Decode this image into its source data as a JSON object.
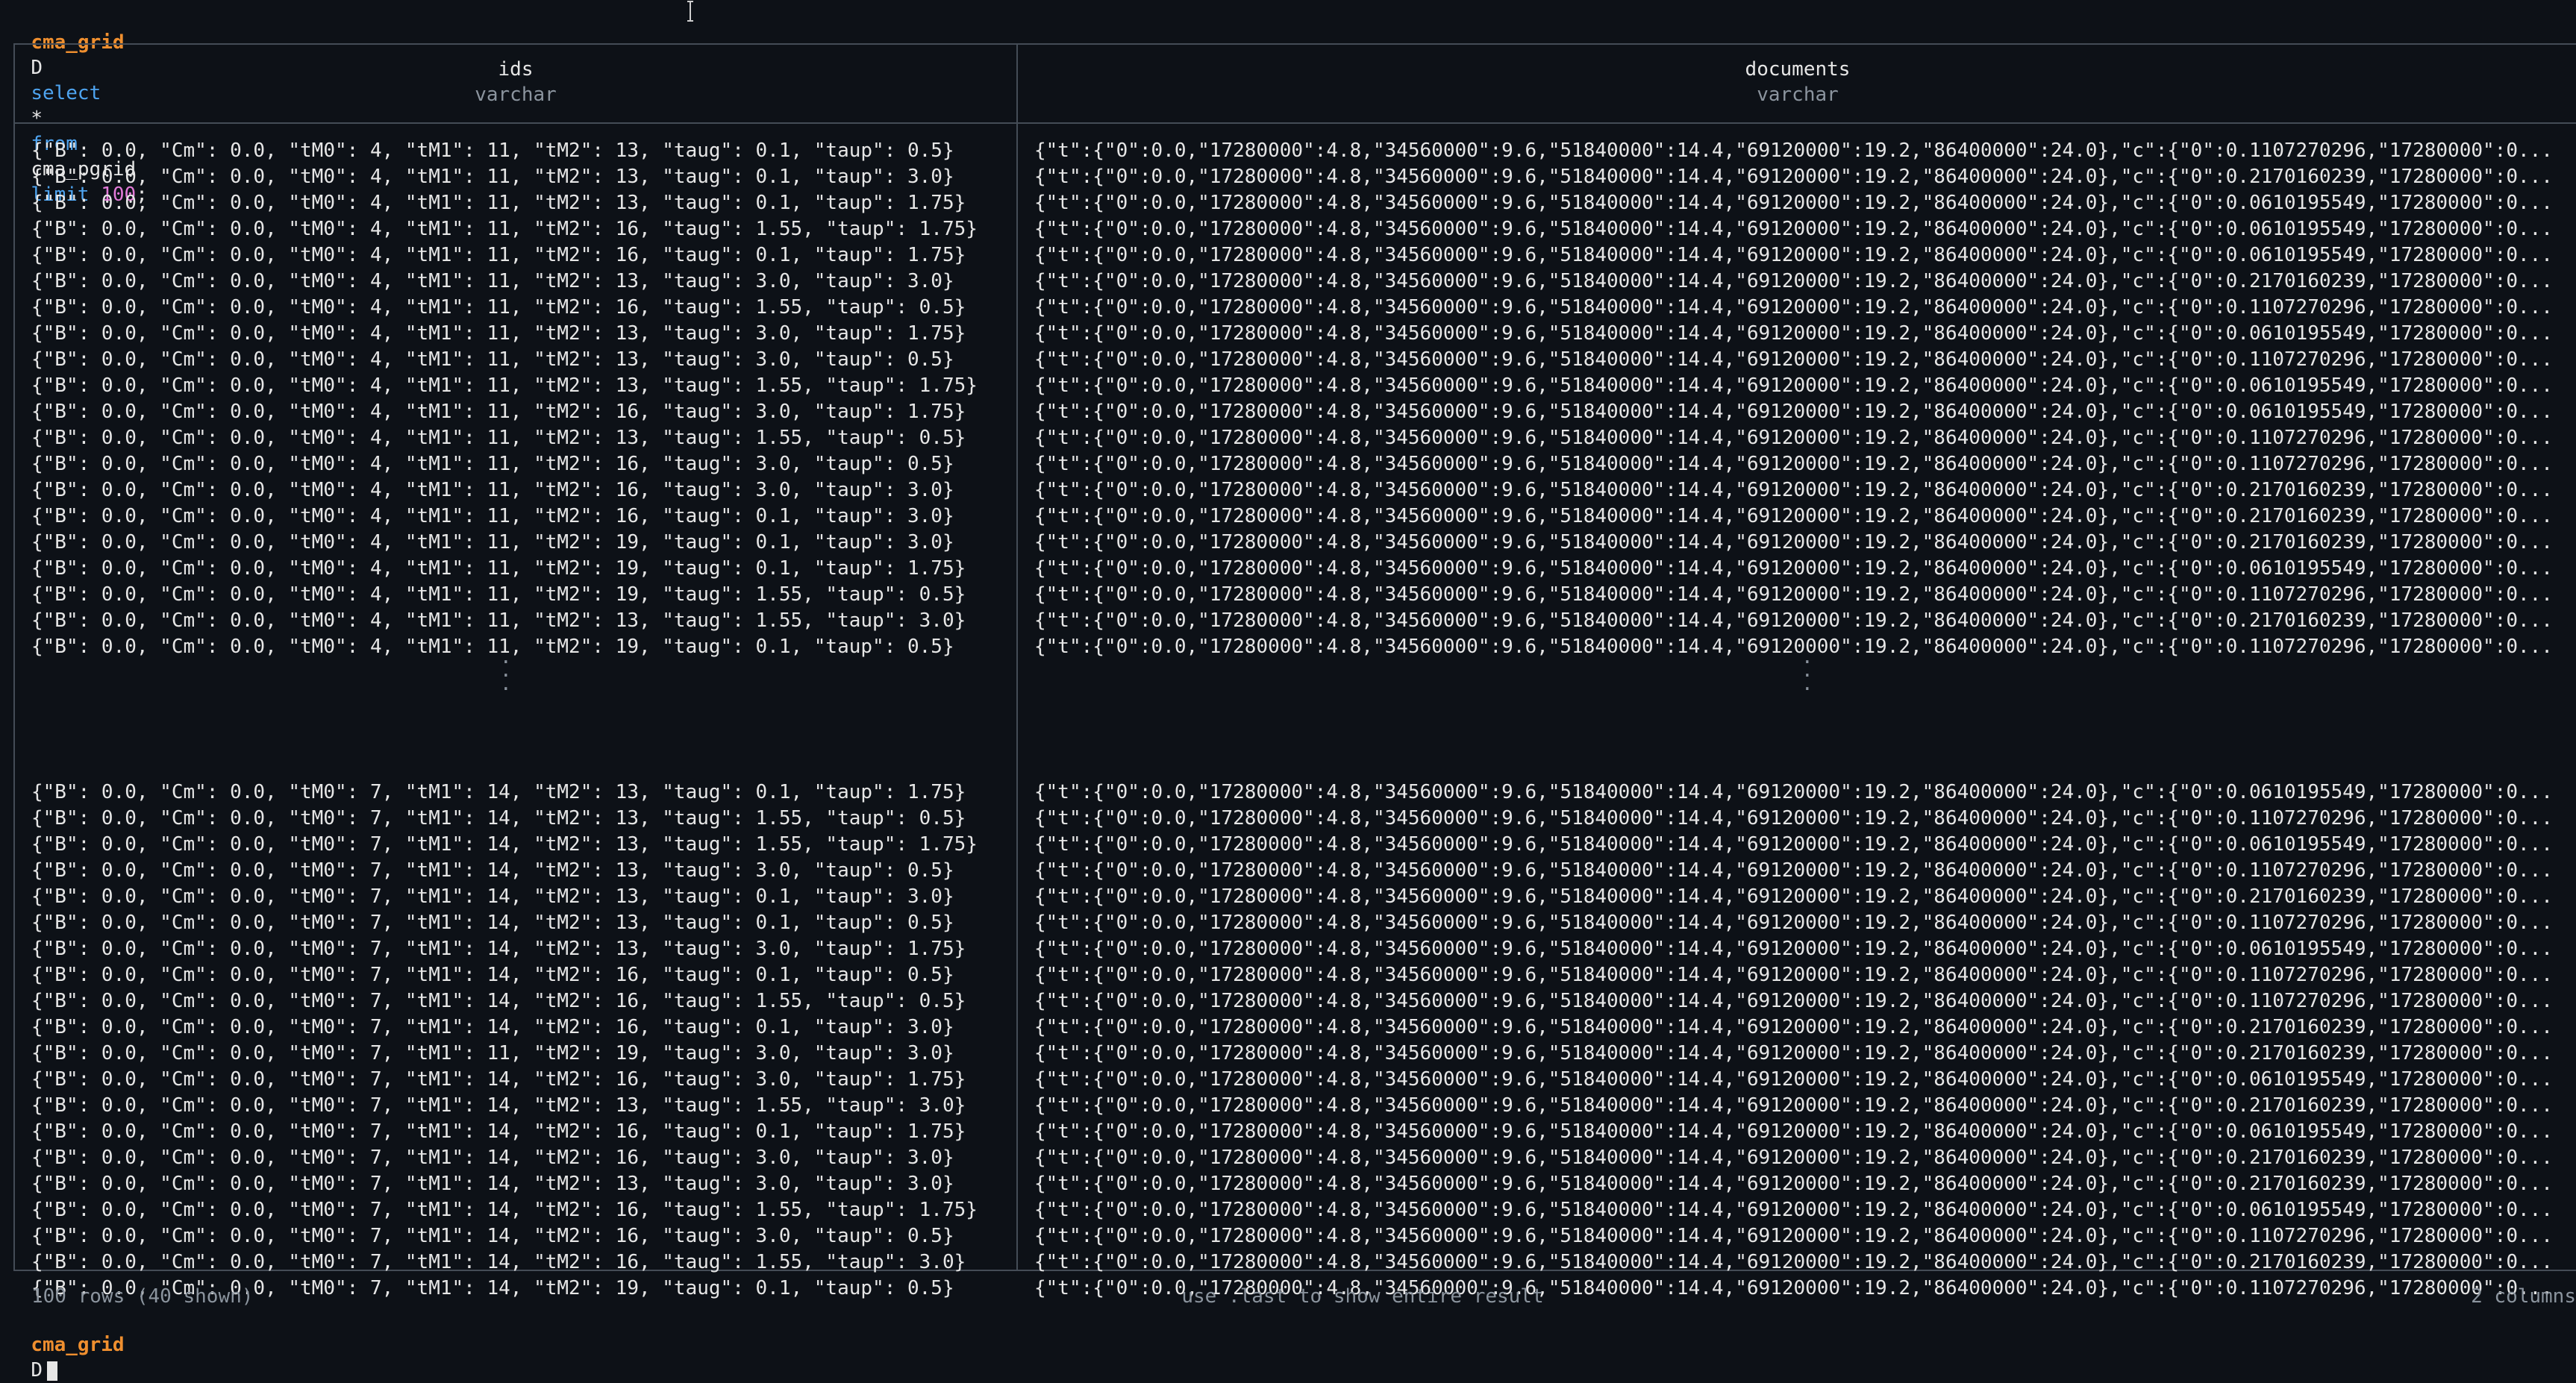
{
  "prompt": {
    "db": "cma_grid",
    "symbol": "D",
    "query_kw1": "select",
    "query_star": "*",
    "query_kw2": "from",
    "query_table": "cma_pgrid",
    "query_kw3": "limit",
    "query_limit": "100",
    "query_end": ";"
  },
  "columns": [
    {
      "name": "ids",
      "type": "varchar"
    },
    {
      "name": "documents",
      "type": "varchar"
    }
  ],
  "rows_top": [
    {
      "ids": "{\"B\": 0.0, \"Cm\": 0.0, \"tM0\": 4, \"tM1\": 11, \"tM2\": 13, \"taug\": 0.1, \"taup\": 0.5}",
      "doc": "{\"t\":{\"0\":0.0,\"17280000\":4.8,\"34560000\":9.6,\"51840000\":14.4,\"69120000\":19.2,\"86400000\":24.0},\"c\":{\"0\":0.1107270296,\"17280000\":0..."
    },
    {
      "ids": "{\"B\": 0.0, \"Cm\": 0.0, \"tM0\": 4, \"tM1\": 11, \"tM2\": 13, \"taug\": 0.1, \"taup\": 3.0}",
      "doc": "{\"t\":{\"0\":0.0,\"17280000\":4.8,\"34560000\":9.6,\"51840000\":14.4,\"69120000\":19.2,\"86400000\":24.0},\"c\":{\"0\":0.2170160239,\"17280000\":0..."
    },
    {
      "ids": "{\"B\": 0.0, \"Cm\": 0.0, \"tM0\": 4, \"tM1\": 11, \"tM2\": 13, \"taug\": 0.1, \"taup\": 1.75}",
      "doc": "{\"t\":{\"0\":0.0,\"17280000\":4.8,\"34560000\":9.6,\"51840000\":14.4,\"69120000\":19.2,\"86400000\":24.0},\"c\":{\"0\":0.0610195549,\"17280000\":0..."
    },
    {
      "ids": "{\"B\": 0.0, \"Cm\": 0.0, \"tM0\": 4, \"tM1\": 11, \"tM2\": 16, \"taug\": 1.55, \"taup\": 1.75}",
      "doc": "{\"t\":{\"0\":0.0,\"17280000\":4.8,\"34560000\":9.6,\"51840000\":14.4,\"69120000\":19.2,\"86400000\":24.0},\"c\":{\"0\":0.0610195549,\"17280000\":0..."
    },
    {
      "ids": "{\"B\": 0.0, \"Cm\": 0.0, \"tM0\": 4, \"tM1\": 11, \"tM2\": 16, \"taug\": 0.1, \"taup\": 1.75}",
      "doc": "{\"t\":{\"0\":0.0,\"17280000\":4.8,\"34560000\":9.6,\"51840000\":14.4,\"69120000\":19.2,\"86400000\":24.0},\"c\":{\"0\":0.0610195549,\"17280000\":0..."
    },
    {
      "ids": "{\"B\": 0.0, \"Cm\": 0.0, \"tM0\": 4, \"tM1\": 11, \"tM2\": 13, \"taug\": 3.0, \"taup\": 3.0}",
      "doc": "{\"t\":{\"0\":0.0,\"17280000\":4.8,\"34560000\":9.6,\"51840000\":14.4,\"69120000\":19.2,\"86400000\":24.0},\"c\":{\"0\":0.2170160239,\"17280000\":0..."
    },
    {
      "ids": "{\"B\": 0.0, \"Cm\": 0.0, \"tM0\": 4, \"tM1\": 11, \"tM2\": 16, \"taug\": 1.55, \"taup\": 0.5}",
      "doc": "{\"t\":{\"0\":0.0,\"17280000\":4.8,\"34560000\":9.6,\"51840000\":14.4,\"69120000\":19.2,\"86400000\":24.0},\"c\":{\"0\":0.1107270296,\"17280000\":0..."
    },
    {
      "ids": "{\"B\": 0.0, \"Cm\": 0.0, \"tM0\": 4, \"tM1\": 11, \"tM2\": 13, \"taug\": 3.0, \"taup\": 1.75}",
      "doc": "{\"t\":{\"0\":0.0,\"17280000\":4.8,\"34560000\":9.6,\"51840000\":14.4,\"69120000\":19.2,\"86400000\":24.0},\"c\":{\"0\":0.0610195549,\"17280000\":0..."
    },
    {
      "ids": "{\"B\": 0.0, \"Cm\": 0.0, \"tM0\": 4, \"tM1\": 11, \"tM2\": 13, \"taug\": 3.0, \"taup\": 0.5}",
      "doc": "{\"t\":{\"0\":0.0,\"17280000\":4.8,\"34560000\":9.6,\"51840000\":14.4,\"69120000\":19.2,\"86400000\":24.0},\"c\":{\"0\":0.1107270296,\"17280000\":0..."
    },
    {
      "ids": "{\"B\": 0.0, \"Cm\": 0.0, \"tM0\": 4, \"tM1\": 11, \"tM2\": 13, \"taug\": 1.55, \"taup\": 1.75}",
      "doc": "{\"t\":{\"0\":0.0,\"17280000\":4.8,\"34560000\":9.6,\"51840000\":14.4,\"69120000\":19.2,\"86400000\":24.0},\"c\":{\"0\":0.0610195549,\"17280000\":0..."
    },
    {
      "ids": "{\"B\": 0.0, \"Cm\": 0.0, \"tM0\": 4, \"tM1\": 11, \"tM2\": 16, \"taug\": 3.0, \"taup\": 1.75}",
      "doc": "{\"t\":{\"0\":0.0,\"17280000\":4.8,\"34560000\":9.6,\"51840000\":14.4,\"69120000\":19.2,\"86400000\":24.0},\"c\":{\"0\":0.0610195549,\"17280000\":0..."
    },
    {
      "ids": "{\"B\": 0.0, \"Cm\": 0.0, \"tM0\": 4, \"tM1\": 11, \"tM2\": 13, \"taug\": 1.55, \"taup\": 0.5}",
      "doc": "{\"t\":{\"0\":0.0,\"17280000\":4.8,\"34560000\":9.6,\"51840000\":14.4,\"69120000\":19.2,\"86400000\":24.0},\"c\":{\"0\":0.1107270296,\"17280000\":0..."
    },
    {
      "ids": "{\"B\": 0.0, \"Cm\": 0.0, \"tM0\": 4, \"tM1\": 11, \"tM2\": 16, \"taug\": 3.0, \"taup\": 0.5}",
      "doc": "{\"t\":{\"0\":0.0,\"17280000\":4.8,\"34560000\":9.6,\"51840000\":14.4,\"69120000\":19.2,\"86400000\":24.0},\"c\":{\"0\":0.1107270296,\"17280000\":0..."
    },
    {
      "ids": "{\"B\": 0.0, \"Cm\": 0.0, \"tM0\": 4, \"tM1\": 11, \"tM2\": 16, \"taug\": 3.0, \"taup\": 3.0}",
      "doc": "{\"t\":{\"0\":0.0,\"17280000\":4.8,\"34560000\":9.6,\"51840000\":14.4,\"69120000\":19.2,\"86400000\":24.0},\"c\":{\"0\":0.2170160239,\"17280000\":0..."
    },
    {
      "ids": "{\"B\": 0.0, \"Cm\": 0.0, \"tM0\": 4, \"tM1\": 11, \"tM2\": 16, \"taug\": 0.1, \"taup\": 3.0}",
      "doc": "{\"t\":{\"0\":0.0,\"17280000\":4.8,\"34560000\":9.6,\"51840000\":14.4,\"69120000\":19.2,\"86400000\":24.0},\"c\":{\"0\":0.2170160239,\"17280000\":0..."
    },
    {
      "ids": "{\"B\": 0.0, \"Cm\": 0.0, \"tM0\": 4, \"tM1\": 11, \"tM2\": 19, \"taug\": 0.1, \"taup\": 3.0}",
      "doc": "{\"t\":{\"0\":0.0,\"17280000\":4.8,\"34560000\":9.6,\"51840000\":14.4,\"69120000\":19.2,\"86400000\":24.0},\"c\":{\"0\":0.2170160239,\"17280000\":0..."
    },
    {
      "ids": "{\"B\": 0.0, \"Cm\": 0.0, \"tM0\": 4, \"tM1\": 11, \"tM2\": 19, \"taug\": 0.1, \"taup\": 1.75}",
      "doc": "{\"t\":{\"0\":0.0,\"17280000\":4.8,\"34560000\":9.6,\"51840000\":14.4,\"69120000\":19.2,\"86400000\":24.0},\"c\":{\"0\":0.0610195549,\"17280000\":0..."
    },
    {
      "ids": "{\"B\": 0.0, \"Cm\": 0.0, \"tM0\": 4, \"tM1\": 11, \"tM2\": 19, \"taug\": 1.55, \"taup\": 0.5}",
      "doc": "{\"t\":{\"0\":0.0,\"17280000\":4.8,\"34560000\":9.6,\"51840000\":14.4,\"69120000\":19.2,\"86400000\":24.0},\"c\":{\"0\":0.1107270296,\"17280000\":0..."
    },
    {
      "ids": "{\"B\": 0.0, \"Cm\": 0.0, \"tM0\": 4, \"tM1\": 11, \"tM2\": 13, \"taug\": 1.55, \"taup\": 3.0}",
      "doc": "{\"t\":{\"0\":0.0,\"17280000\":4.8,\"34560000\":9.6,\"51840000\":14.4,\"69120000\":19.2,\"86400000\":24.0},\"c\":{\"0\":0.2170160239,\"17280000\":0..."
    },
    {
      "ids": "{\"B\": 0.0, \"Cm\": 0.0, \"tM0\": 4, \"tM1\": 11, \"tM2\": 19, \"taug\": 0.1, \"taup\": 0.5}",
      "doc": "{\"t\":{\"0\":0.0,\"17280000\":4.8,\"34560000\":9.6,\"51840000\":14.4,\"69120000\":19.2,\"86400000\":24.0},\"c\":{\"0\":0.1107270296,\"17280000\":0..."
    }
  ],
  "ellipsis": [
    "·",
    "·",
    "·"
  ],
  "rows_bottom": [
    {
      "ids": "{\"B\": 0.0, \"Cm\": 0.0, \"tM0\": 7, \"tM1\": 14, \"tM2\": 13, \"taug\": 0.1, \"taup\": 1.75}",
      "doc": "{\"t\":{\"0\":0.0,\"17280000\":4.8,\"34560000\":9.6,\"51840000\":14.4,\"69120000\":19.2,\"86400000\":24.0},\"c\":{\"0\":0.0610195549,\"17280000\":0..."
    },
    {
      "ids": "{\"B\": 0.0, \"Cm\": 0.0, \"tM0\": 7, \"tM1\": 14, \"tM2\": 13, \"taug\": 1.55, \"taup\": 0.5}",
      "doc": "{\"t\":{\"0\":0.0,\"17280000\":4.8,\"34560000\":9.6,\"51840000\":14.4,\"69120000\":19.2,\"86400000\":24.0},\"c\":{\"0\":0.1107270296,\"17280000\":0..."
    },
    {
      "ids": "{\"B\": 0.0, \"Cm\": 0.0, \"tM0\": 7, \"tM1\": 14, \"tM2\": 13, \"taug\": 1.55, \"taup\": 1.75}",
      "doc": "{\"t\":{\"0\":0.0,\"17280000\":4.8,\"34560000\":9.6,\"51840000\":14.4,\"69120000\":19.2,\"86400000\":24.0},\"c\":{\"0\":0.0610195549,\"17280000\":0..."
    },
    {
      "ids": "{\"B\": 0.0, \"Cm\": 0.0, \"tM0\": 7, \"tM1\": 14, \"tM2\": 13, \"taug\": 3.0, \"taup\": 0.5}",
      "doc": "{\"t\":{\"0\":0.0,\"17280000\":4.8,\"34560000\":9.6,\"51840000\":14.4,\"69120000\":19.2,\"86400000\":24.0},\"c\":{\"0\":0.1107270296,\"17280000\":0..."
    },
    {
      "ids": "{\"B\": 0.0, \"Cm\": 0.0, \"tM0\": 7, \"tM1\": 14, \"tM2\": 13, \"taug\": 0.1, \"taup\": 3.0}",
      "doc": "{\"t\":{\"0\":0.0,\"17280000\":4.8,\"34560000\":9.6,\"51840000\":14.4,\"69120000\":19.2,\"86400000\":24.0},\"c\":{\"0\":0.2170160239,\"17280000\":0..."
    },
    {
      "ids": "{\"B\": 0.0, \"Cm\": 0.0, \"tM0\": 7, \"tM1\": 14, \"tM2\": 13, \"taug\": 0.1, \"taup\": 0.5}",
      "doc": "{\"t\":{\"0\":0.0,\"17280000\":4.8,\"34560000\":9.6,\"51840000\":14.4,\"69120000\":19.2,\"86400000\":24.0},\"c\":{\"0\":0.1107270296,\"17280000\":0..."
    },
    {
      "ids": "{\"B\": 0.0, \"Cm\": 0.0, \"tM0\": 7, \"tM1\": 14, \"tM2\": 13, \"taug\": 3.0, \"taup\": 1.75}",
      "doc": "{\"t\":{\"0\":0.0,\"17280000\":4.8,\"34560000\":9.6,\"51840000\":14.4,\"69120000\":19.2,\"86400000\":24.0},\"c\":{\"0\":0.0610195549,\"17280000\":0..."
    },
    {
      "ids": "{\"B\": 0.0, \"Cm\": 0.0, \"tM0\": 7, \"tM1\": 14, \"tM2\": 16, \"taug\": 0.1, \"taup\": 0.5}",
      "doc": "{\"t\":{\"0\":0.0,\"17280000\":4.8,\"34560000\":9.6,\"51840000\":14.4,\"69120000\":19.2,\"86400000\":24.0},\"c\":{\"0\":0.1107270296,\"17280000\":0..."
    },
    {
      "ids": "{\"B\": 0.0, \"Cm\": 0.0, \"tM0\": 7, \"tM1\": 14, \"tM2\": 16, \"taug\": 1.55, \"taup\": 0.5}",
      "doc": "{\"t\":{\"0\":0.0,\"17280000\":4.8,\"34560000\":9.6,\"51840000\":14.4,\"69120000\":19.2,\"86400000\":24.0},\"c\":{\"0\":0.1107270296,\"17280000\":0..."
    },
    {
      "ids": "{\"B\": 0.0, \"Cm\": 0.0, \"tM0\": 7, \"tM1\": 14, \"tM2\": 16, \"taug\": 0.1, \"taup\": 3.0}",
      "doc": "{\"t\":{\"0\":0.0,\"17280000\":4.8,\"34560000\":9.6,\"51840000\":14.4,\"69120000\":19.2,\"86400000\":24.0},\"c\":{\"0\":0.2170160239,\"17280000\":0..."
    },
    {
      "ids": "{\"B\": 0.0, \"Cm\": 0.0, \"tM0\": 7, \"tM1\": 11, \"tM2\": 19, \"taug\": 3.0, \"taup\": 3.0}",
      "doc": "{\"t\":{\"0\":0.0,\"17280000\":4.8,\"34560000\":9.6,\"51840000\":14.4,\"69120000\":19.2,\"86400000\":24.0},\"c\":{\"0\":0.2170160239,\"17280000\":0..."
    },
    {
      "ids": "{\"B\": 0.0, \"Cm\": 0.0, \"tM0\": 7, \"tM1\": 14, \"tM2\": 16, \"taug\": 3.0, \"taup\": 1.75}",
      "doc": "{\"t\":{\"0\":0.0,\"17280000\":4.8,\"34560000\":9.6,\"51840000\":14.4,\"69120000\":19.2,\"86400000\":24.0},\"c\":{\"0\":0.0610195549,\"17280000\":0..."
    },
    {
      "ids": "{\"B\": 0.0, \"Cm\": 0.0, \"tM0\": 7, \"tM1\": 14, \"tM2\": 13, \"taug\": 1.55, \"taup\": 3.0}",
      "doc": "{\"t\":{\"0\":0.0,\"17280000\":4.8,\"34560000\":9.6,\"51840000\":14.4,\"69120000\":19.2,\"86400000\":24.0},\"c\":{\"0\":0.2170160239,\"17280000\":0..."
    },
    {
      "ids": "{\"B\": 0.0, \"Cm\": 0.0, \"tM0\": 7, \"tM1\": 14, \"tM2\": 16, \"taug\": 0.1, \"taup\": 1.75}",
      "doc": "{\"t\":{\"0\":0.0,\"17280000\":4.8,\"34560000\":9.6,\"51840000\":14.4,\"69120000\":19.2,\"86400000\":24.0},\"c\":{\"0\":0.0610195549,\"17280000\":0..."
    },
    {
      "ids": "{\"B\": 0.0, \"Cm\": 0.0, \"tM0\": 7, \"tM1\": 14, \"tM2\": 16, \"taug\": 3.0, \"taup\": 3.0}",
      "doc": "{\"t\":{\"0\":0.0,\"17280000\":4.8,\"34560000\":9.6,\"51840000\":14.4,\"69120000\":19.2,\"86400000\":24.0},\"c\":{\"0\":0.2170160239,\"17280000\":0..."
    },
    {
      "ids": "{\"B\": 0.0, \"Cm\": 0.0, \"tM0\": 7, \"tM1\": 14, \"tM2\": 13, \"taug\": 3.0, \"taup\": 3.0}",
      "doc": "{\"t\":{\"0\":0.0,\"17280000\":4.8,\"34560000\":9.6,\"51840000\":14.4,\"69120000\":19.2,\"86400000\":24.0},\"c\":{\"0\":0.2170160239,\"17280000\":0..."
    },
    {
      "ids": "{\"B\": 0.0, \"Cm\": 0.0, \"tM0\": 7, \"tM1\": 14, \"tM2\": 16, \"taug\": 1.55, \"taup\": 1.75}",
      "doc": "{\"t\":{\"0\":0.0,\"17280000\":4.8,\"34560000\":9.6,\"51840000\":14.4,\"69120000\":19.2,\"86400000\":24.0},\"c\":{\"0\":0.0610195549,\"17280000\":0..."
    },
    {
      "ids": "{\"B\": 0.0, \"Cm\": 0.0, \"tM0\": 7, \"tM1\": 14, \"tM2\": 16, \"taug\": 3.0, \"taup\": 0.5}",
      "doc": "{\"t\":{\"0\":0.0,\"17280000\":4.8,\"34560000\":9.6,\"51840000\":14.4,\"69120000\":19.2,\"86400000\":24.0},\"c\":{\"0\":0.1107270296,\"17280000\":0..."
    },
    {
      "ids": "{\"B\": 0.0, \"Cm\": 0.0, \"tM0\": 7, \"tM1\": 14, \"tM2\": 16, \"taug\": 1.55, \"taup\": 3.0}",
      "doc": "{\"t\":{\"0\":0.0,\"17280000\":4.8,\"34560000\":9.6,\"51840000\":14.4,\"69120000\":19.2,\"86400000\":24.0},\"c\":{\"0\":0.2170160239,\"17280000\":0..."
    },
    {
      "ids": "{\"B\": 0.0, \"Cm\": 0.0, \"tM0\": 7, \"tM1\": 14, \"tM2\": 19, \"taug\": 0.1, \"taup\": 0.5}",
      "doc": "{\"t\":{\"0\":0.0,\"17280000\":4.8,\"34560000\":9.6,\"51840000\":14.4,\"69120000\":19.2,\"86400000\":24.0},\"c\":{\"0\":0.1107270296,\"17280000\":0..."
    }
  ],
  "footer": {
    "rows_info": "100 rows (40 shown)",
    "hint": "use .last to show entire result",
    "columns_info": "2 columns"
  },
  "colors": {
    "background": "#0d1117",
    "prompt_db": "#ef8f2f",
    "keyword": "#4ea4f0",
    "number": "#e27ad8",
    "muted": "#8b949e"
  }
}
